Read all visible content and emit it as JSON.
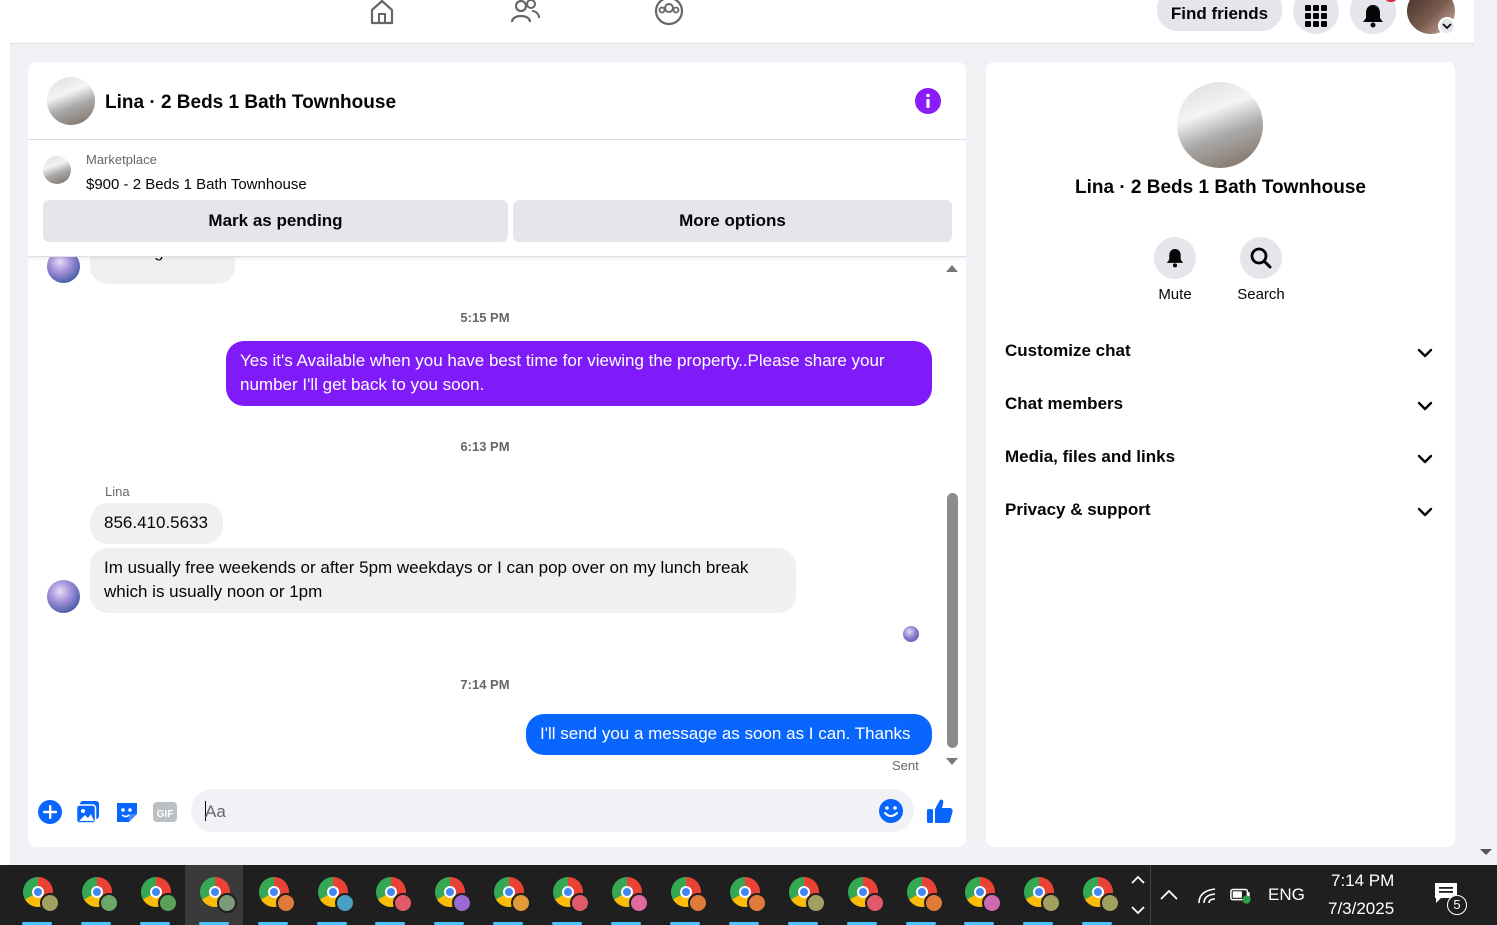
{
  "nav": {
    "find_friends": "Find friends"
  },
  "chat": {
    "title": "Lina · 2 Beds 1 Bath Townhouse",
    "marketplace_label": "Marketplace",
    "listing": "$900 - 2 Beds 1 Bath Townhouse",
    "mark_pending": "Mark as pending",
    "more_options": "More options",
    "partial_top_message": "Message sent",
    "messages": [
      {
        "type": "timestamp",
        "text": "5:15 PM"
      },
      {
        "type": "outgoing",
        "color": "#7f1af8",
        "text": "Yes it's Available when you have best time for viewing the property..Please share your number I'll get back to you soon."
      },
      {
        "type": "timestamp",
        "text": "6:13 PM"
      },
      {
        "type": "sender",
        "text": "Lina"
      },
      {
        "type": "incoming",
        "text": "856.410.5633"
      },
      {
        "type": "incoming",
        "text": "Im usually free weekends or after 5pm weekdays or I can pop over on my lunch break which is usually noon or 1pm"
      },
      {
        "type": "timestamp",
        "text": "7:14 PM"
      },
      {
        "type": "outgoing",
        "color": "#0866ff",
        "text": "I'll send you a message as soon as I can. Thanks"
      },
      {
        "type": "status",
        "text": "Sent"
      }
    ],
    "composer_placeholder": "Aa"
  },
  "info": {
    "title": "Lina · 2 Beds 1 Bath Townhouse",
    "actions": [
      {
        "label": "Mute",
        "icon": "bell-icon"
      },
      {
        "label": "Search",
        "icon": "search-icon"
      }
    ],
    "sections": [
      {
        "label": "Customize chat"
      },
      {
        "label": "Chat members"
      },
      {
        "label": "Media, files and links"
      },
      {
        "label": "Privacy & support"
      }
    ]
  },
  "taskbar": {
    "language": "ENG",
    "time": "7:14 PM",
    "date": "7/3/2025",
    "notification_count": "5",
    "apps": [
      {
        "badge": "#a0a060"
      },
      {
        "badge": "#6aa86a"
      },
      {
        "badge": "#5aa05a"
      },
      {
        "badge": "#7a9a7a"
      },
      {
        "badge": "#e07a3a"
      },
      {
        "badge": "#4aa0c0"
      },
      {
        "badge": "#e05a6a"
      },
      {
        "badge": "#9a6ad0"
      },
      {
        "badge": "#e09a3a"
      },
      {
        "badge": "#e05a6a"
      },
      {
        "badge": "#e06aa0"
      },
      {
        "badge": "#e07a3a"
      },
      {
        "badge": "#e07a3a"
      },
      {
        "badge": "#a0a060"
      },
      {
        "badge": "#e05a6a"
      },
      {
        "badge": "#e07a3a"
      },
      {
        "badge": "#d06ab0"
      },
      {
        "badge": "#a0a060"
      },
      {
        "badge": "#a0a060"
      }
    ]
  }
}
